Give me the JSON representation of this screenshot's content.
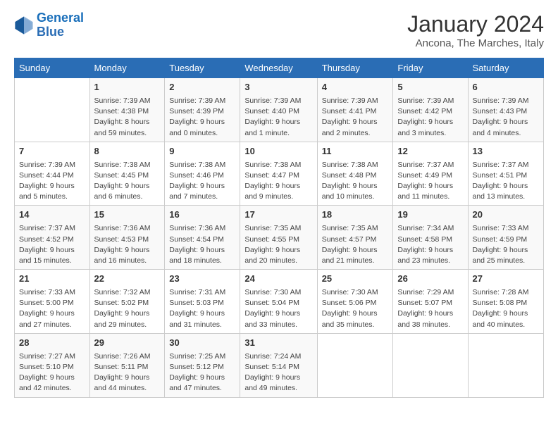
{
  "logo": {
    "line1": "General",
    "line2": "Blue"
  },
  "title": "January 2024",
  "location": "Ancona, The Marches, Italy",
  "days_of_week": [
    "Sunday",
    "Monday",
    "Tuesday",
    "Wednesday",
    "Thursday",
    "Friday",
    "Saturday"
  ],
  "weeks": [
    [
      {
        "day": "",
        "text": ""
      },
      {
        "day": "1",
        "text": "Sunrise: 7:39 AM\nSunset: 4:38 PM\nDaylight: 8 hours\nand 59 minutes."
      },
      {
        "day": "2",
        "text": "Sunrise: 7:39 AM\nSunset: 4:39 PM\nDaylight: 9 hours\nand 0 minutes."
      },
      {
        "day": "3",
        "text": "Sunrise: 7:39 AM\nSunset: 4:40 PM\nDaylight: 9 hours\nand 1 minute."
      },
      {
        "day": "4",
        "text": "Sunrise: 7:39 AM\nSunset: 4:41 PM\nDaylight: 9 hours\nand 2 minutes."
      },
      {
        "day": "5",
        "text": "Sunrise: 7:39 AM\nSunset: 4:42 PM\nDaylight: 9 hours\nand 3 minutes."
      },
      {
        "day": "6",
        "text": "Sunrise: 7:39 AM\nSunset: 4:43 PM\nDaylight: 9 hours\nand 4 minutes."
      }
    ],
    [
      {
        "day": "7",
        "text": "Sunrise: 7:39 AM\nSunset: 4:44 PM\nDaylight: 9 hours\nand 5 minutes."
      },
      {
        "day": "8",
        "text": "Sunrise: 7:38 AM\nSunset: 4:45 PM\nDaylight: 9 hours\nand 6 minutes."
      },
      {
        "day": "9",
        "text": "Sunrise: 7:38 AM\nSunset: 4:46 PM\nDaylight: 9 hours\nand 7 minutes."
      },
      {
        "day": "10",
        "text": "Sunrise: 7:38 AM\nSunset: 4:47 PM\nDaylight: 9 hours\nand 9 minutes."
      },
      {
        "day": "11",
        "text": "Sunrise: 7:38 AM\nSunset: 4:48 PM\nDaylight: 9 hours\nand 10 minutes."
      },
      {
        "day": "12",
        "text": "Sunrise: 7:37 AM\nSunset: 4:49 PM\nDaylight: 9 hours\nand 11 minutes."
      },
      {
        "day": "13",
        "text": "Sunrise: 7:37 AM\nSunset: 4:51 PM\nDaylight: 9 hours\nand 13 minutes."
      }
    ],
    [
      {
        "day": "14",
        "text": "Sunrise: 7:37 AM\nSunset: 4:52 PM\nDaylight: 9 hours\nand 15 minutes."
      },
      {
        "day": "15",
        "text": "Sunrise: 7:36 AM\nSunset: 4:53 PM\nDaylight: 9 hours\nand 16 minutes."
      },
      {
        "day": "16",
        "text": "Sunrise: 7:36 AM\nSunset: 4:54 PM\nDaylight: 9 hours\nand 18 minutes."
      },
      {
        "day": "17",
        "text": "Sunrise: 7:35 AM\nSunset: 4:55 PM\nDaylight: 9 hours\nand 20 minutes."
      },
      {
        "day": "18",
        "text": "Sunrise: 7:35 AM\nSunset: 4:57 PM\nDaylight: 9 hours\nand 21 minutes."
      },
      {
        "day": "19",
        "text": "Sunrise: 7:34 AM\nSunset: 4:58 PM\nDaylight: 9 hours\nand 23 minutes."
      },
      {
        "day": "20",
        "text": "Sunrise: 7:33 AM\nSunset: 4:59 PM\nDaylight: 9 hours\nand 25 minutes."
      }
    ],
    [
      {
        "day": "21",
        "text": "Sunrise: 7:33 AM\nSunset: 5:00 PM\nDaylight: 9 hours\nand 27 minutes."
      },
      {
        "day": "22",
        "text": "Sunrise: 7:32 AM\nSunset: 5:02 PM\nDaylight: 9 hours\nand 29 minutes."
      },
      {
        "day": "23",
        "text": "Sunrise: 7:31 AM\nSunset: 5:03 PM\nDaylight: 9 hours\nand 31 minutes."
      },
      {
        "day": "24",
        "text": "Sunrise: 7:30 AM\nSunset: 5:04 PM\nDaylight: 9 hours\nand 33 minutes."
      },
      {
        "day": "25",
        "text": "Sunrise: 7:30 AM\nSunset: 5:06 PM\nDaylight: 9 hours\nand 35 minutes."
      },
      {
        "day": "26",
        "text": "Sunrise: 7:29 AM\nSunset: 5:07 PM\nDaylight: 9 hours\nand 38 minutes."
      },
      {
        "day": "27",
        "text": "Sunrise: 7:28 AM\nSunset: 5:08 PM\nDaylight: 9 hours\nand 40 minutes."
      }
    ],
    [
      {
        "day": "28",
        "text": "Sunrise: 7:27 AM\nSunset: 5:10 PM\nDaylight: 9 hours\nand 42 minutes."
      },
      {
        "day": "29",
        "text": "Sunrise: 7:26 AM\nSunset: 5:11 PM\nDaylight: 9 hours\nand 44 minutes."
      },
      {
        "day": "30",
        "text": "Sunrise: 7:25 AM\nSunset: 5:12 PM\nDaylight: 9 hours\nand 47 minutes."
      },
      {
        "day": "31",
        "text": "Sunrise: 7:24 AM\nSunset: 5:14 PM\nDaylight: 9 hours\nand 49 minutes."
      },
      {
        "day": "",
        "text": ""
      },
      {
        "day": "",
        "text": ""
      },
      {
        "day": "",
        "text": ""
      }
    ]
  ]
}
